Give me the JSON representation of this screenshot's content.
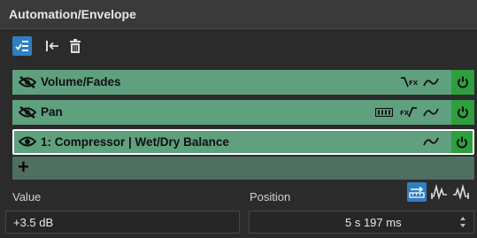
{
  "panel": {
    "title": "Automation/Envelope"
  },
  "toolbar": {
    "buttons": [
      {
        "name": "show-all-envelopes",
        "icon": "list-check-icon",
        "active": true
      },
      {
        "name": "collapse-to-left",
        "icon": "arrow-to-left-icon",
        "active": false
      },
      {
        "name": "delete-envelope",
        "icon": "trash-icon",
        "active": false
      }
    ]
  },
  "envelopes": [
    {
      "label": "Volume/Fades",
      "visible": false,
      "icons": [
        "fade-fx-icon",
        "curve-icon"
      ],
      "power": true
    },
    {
      "label": "Pan",
      "visible": false,
      "icons": [
        "pan-mode-icon",
        "pan-fx-icon",
        "curve-icon"
      ],
      "power": true
    },
    {
      "label": "1: Compressor | Wet/Dry Balance",
      "visible": true,
      "selected": true,
      "icons": [
        "curve-icon"
      ],
      "power": true
    }
  ],
  "add_row": {
    "label": "+"
  },
  "value": {
    "label": "Value",
    "text": "+3.5 dB"
  },
  "position": {
    "label": "Position",
    "text": "5 s 197 ms"
  },
  "mode_buttons": [
    {
      "name": "time-ruler-mode",
      "icon": "ruler-arrow-icon",
      "active": true
    },
    {
      "name": "snap-left-mode",
      "icon": "wave-left-icon",
      "active": false
    },
    {
      "name": "snap-right-mode",
      "icon": "wave-right-icon",
      "active": false
    }
  ],
  "colors": {
    "background": "#2b2b2b",
    "envelope_row": "#5fa07f",
    "power_button": "#2e9e3e",
    "accent_blue": "#2f7fc2",
    "add_row": "#4f6f60"
  }
}
